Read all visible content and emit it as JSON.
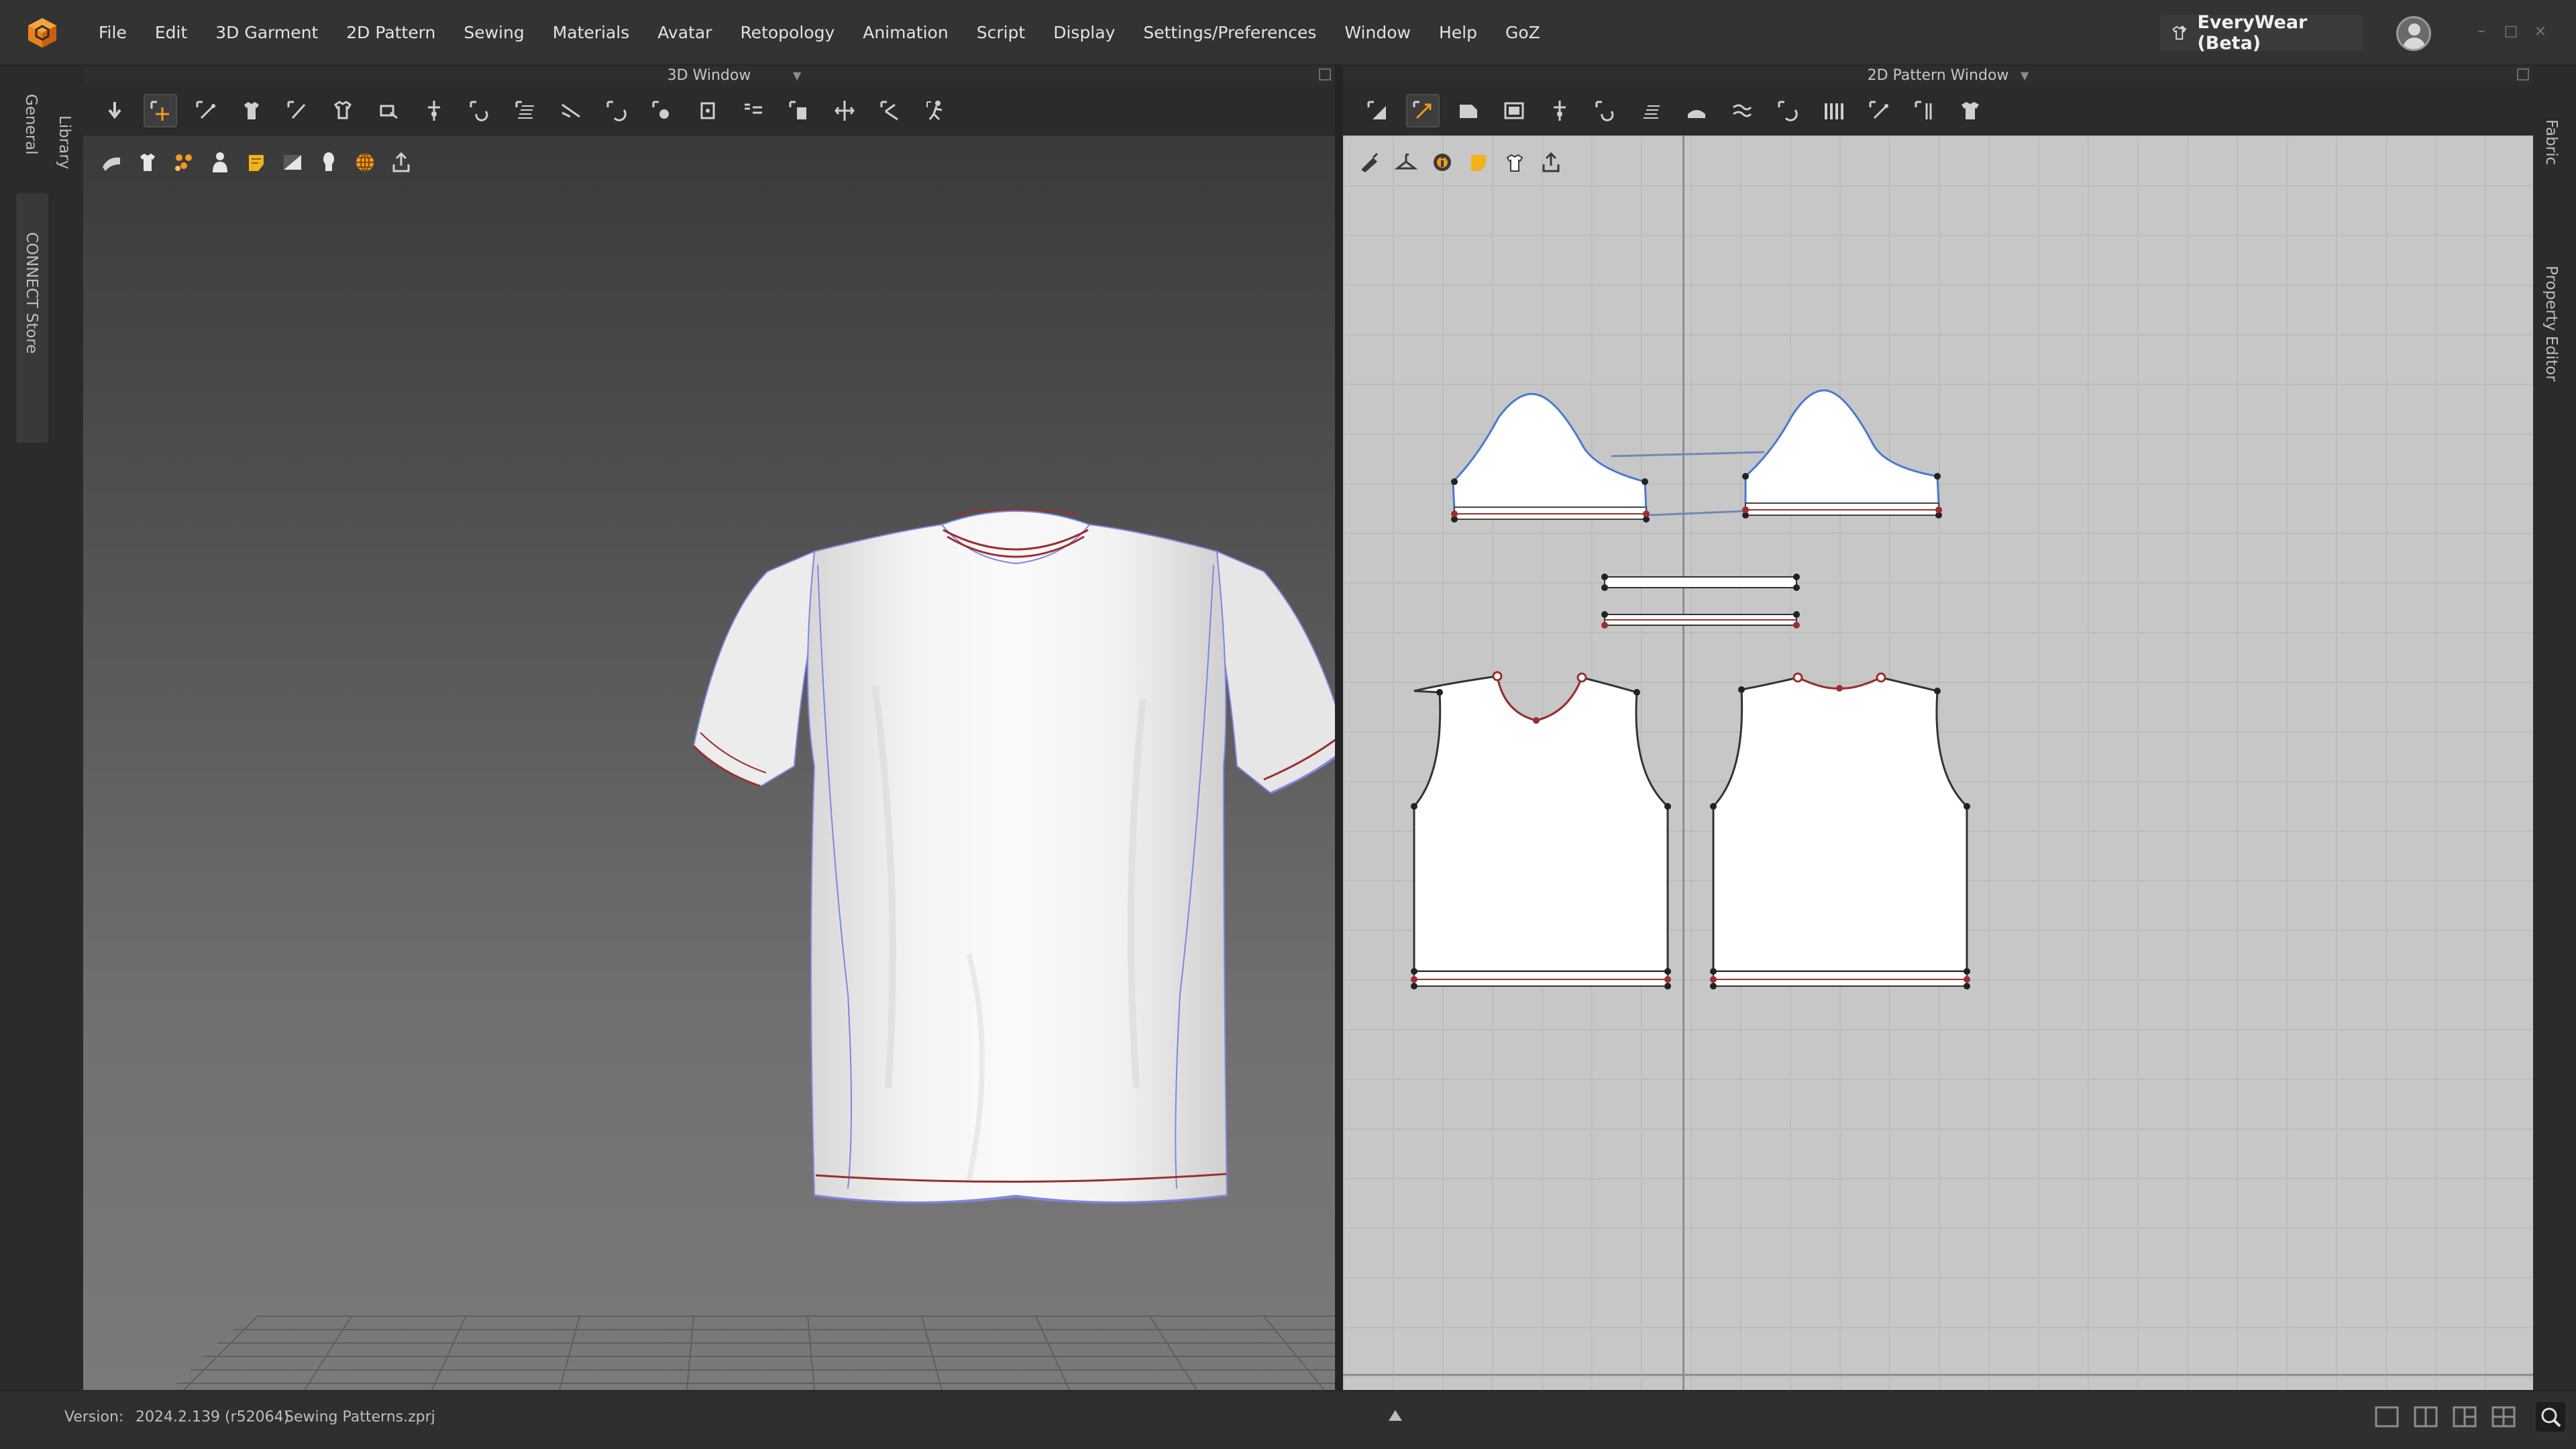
{
  "app": {
    "logo": "clo-cube-logo",
    "menu": [
      "File",
      "Edit",
      "3D Garment",
      "2D Pattern",
      "Sewing",
      "Materials",
      "Avatar",
      "Retopology",
      "Animation",
      "Script",
      "Display",
      "Settings/Preferences",
      "Window",
      "Help",
      "GoZ"
    ],
    "everywear_label": "EveryWear (Beta)",
    "window_controls": [
      "minimize",
      "maximize",
      "close"
    ]
  },
  "left_rail": {
    "general": "General",
    "library": "Library",
    "connect_store": "CONNECT Store"
  },
  "right_rail": {
    "fabric": "Fabric",
    "property_editor": "Property Editor"
  },
  "window_3d": {
    "title": "3D Window",
    "toolbar_icons": [
      "simulation-icon",
      "select-move-icon",
      "select-mesh-icon",
      "fold-arrangement-icon",
      "pin-icon",
      "tack-icon",
      "box-select-icon",
      "trace-icon",
      "move-anchor-icon",
      "flip-icon",
      "strap-icon",
      "puckering-icon",
      "shirring-icon",
      "button-icon",
      "buttonhole-icon",
      "zipper-icon",
      "elastic-icon",
      "measure-icon",
      "pose-icon",
      "avatar-motion-icon"
    ],
    "subtool_icons": [
      "fabric-texture-icon",
      "garment-icon",
      "arrangement-icon",
      "avatar-display-icon",
      "fabric-render-icon",
      "background-icon",
      "avatar-head-icon",
      "wireframe-globe-icon",
      "export-icon"
    ]
  },
  "window_2d": {
    "title": "2D Pattern Window",
    "toolbar_icons": [
      "edit-pattern-icon",
      "transform-pattern-icon",
      "polygon-icon",
      "rectangle-icon",
      "internal-line-icon",
      "seam-allowance-icon",
      "grain-icon",
      "fold-icon",
      "notch-icon",
      "segment-sewing-icon",
      "free-sewing-icon",
      "pleats-icon",
      "measure-segment-icon",
      "trace-2d-icon",
      "tshirt-icon"
    ],
    "subtool_icons": [
      "pen-icon",
      "hanger-icon",
      "info-icon",
      "fabric-icon",
      "tshirt-outline-icon",
      "export-2d-icon"
    ]
  },
  "status": {
    "version_label": "Version:",
    "version": "2024.2.139 (r52064)",
    "file": "Sewing Patterns.zprj",
    "layouts": [
      "single-view-icon",
      "split-view-icon",
      "three-view-icon",
      "quad-view-icon"
    ]
  },
  "colors": {
    "accent": "#f39a1c",
    "seam_red": "#9b2f2f",
    "seam_blue": "#6f74d6",
    "pattern_fill": "#ffffff",
    "canvas_2d": "#c7c7c7"
  }
}
